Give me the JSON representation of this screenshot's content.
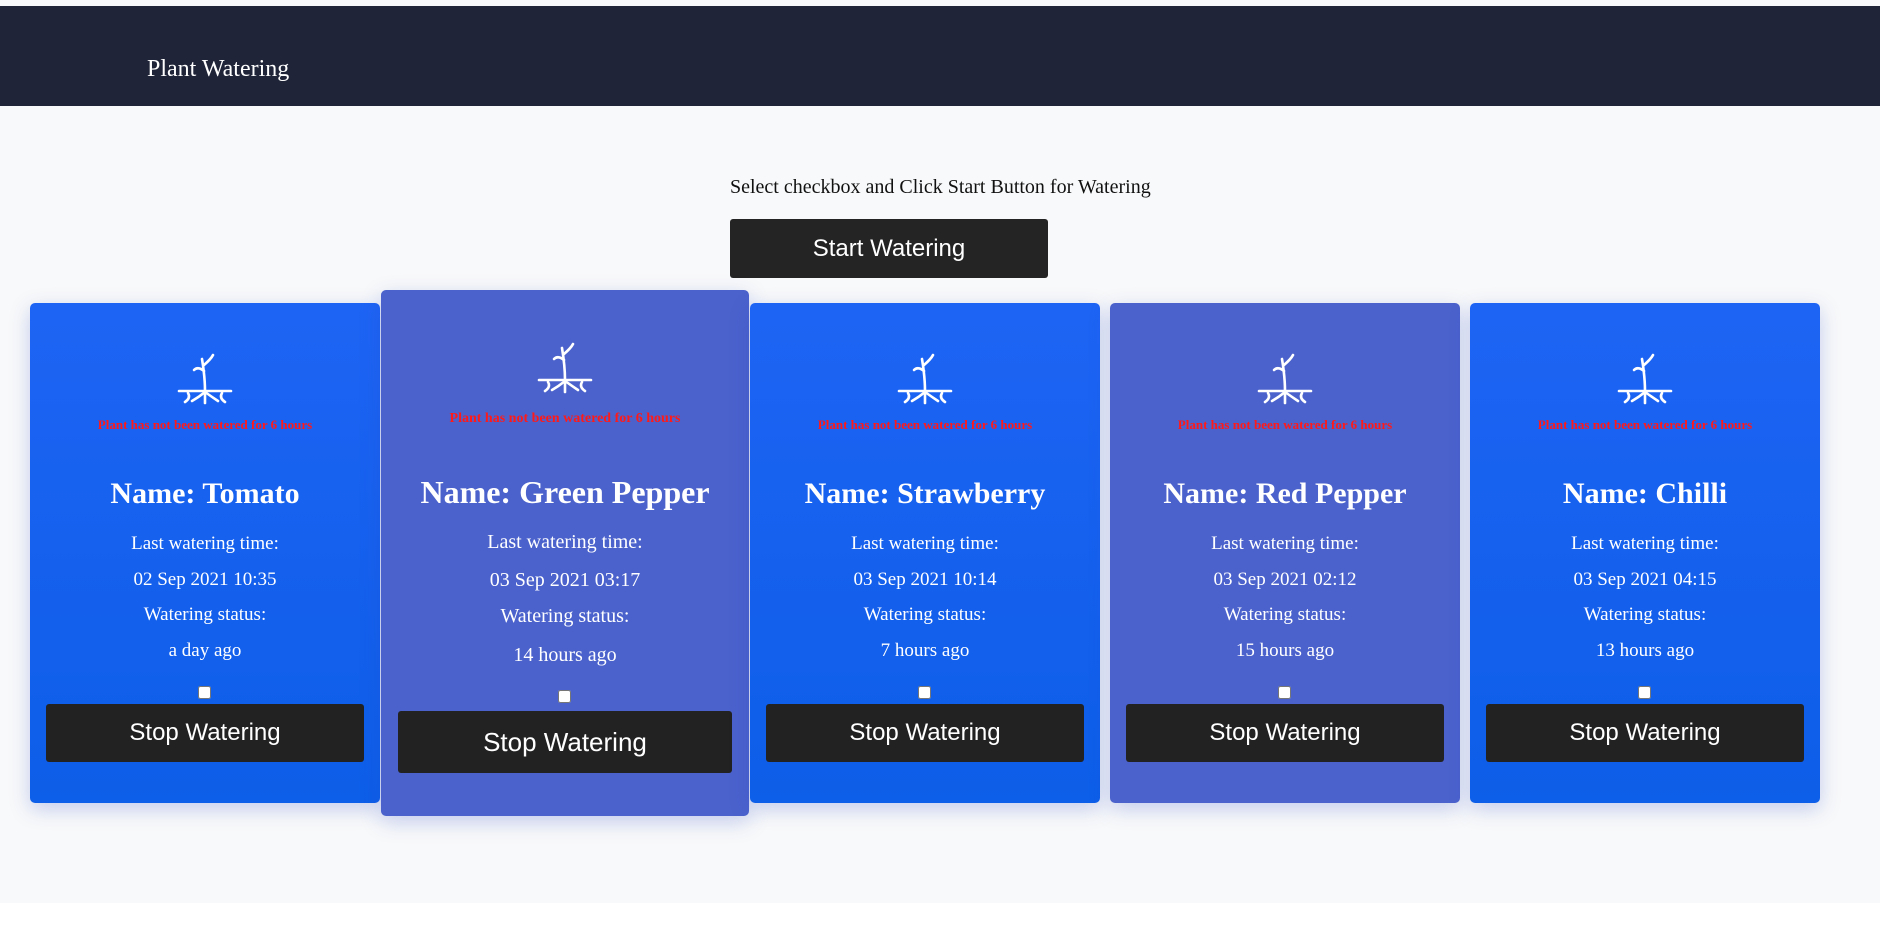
{
  "navbar": {
    "brand": "Plant Watering"
  },
  "main": {
    "instruction": "Select checkbox and Click Start Button for Watering",
    "start_button": "Start Watering"
  },
  "colors": {
    "navbar_bg": "#1f2438",
    "card_blue": "#1e64f4",
    "card_selected": "#4b62cc",
    "button_dark": "#222222",
    "warning_red": "#ff1a1a"
  },
  "cards": [
    {
      "icon": "plant-sprout-icon",
      "warning": "Plant has not been watered for 6 hours",
      "name": "Name: Tomato",
      "last_label": "Last watering time:",
      "last_time": "02 Sep 2021 10:35",
      "status_label": "Watering status:",
      "status": "a day ago",
      "checked": false,
      "stop_button": "Stop Watering"
    },
    {
      "icon": "plant-sprout-icon",
      "warning": "Plant has not been watered for 6 hours",
      "name": "Name: Green Pepper",
      "last_label": "Last watering time:",
      "last_time": "03 Sep 2021 03:17",
      "status_label": "Watering status:",
      "status": "14 hours ago",
      "checked": false,
      "stop_button": "Stop Watering"
    },
    {
      "icon": "plant-sprout-icon",
      "warning": "Plant has not been watered for 6 hours",
      "name": "Name: Strawberry",
      "last_label": "Last watering time:",
      "last_time": "03 Sep 2021 10:14",
      "status_label": "Watering status:",
      "status": "7 hours ago",
      "checked": false,
      "stop_button": "Stop Watering"
    },
    {
      "icon": "plant-sprout-icon",
      "warning": "Plant has not been watered for 6 hours",
      "name": "Name: Red Pepper",
      "last_label": "Last watering time:",
      "last_time": "03 Sep 2021 02:12",
      "status_label": "Watering status:",
      "status": "15 hours ago",
      "checked": false,
      "stop_button": "Stop Watering"
    },
    {
      "icon": "plant-sprout-icon",
      "warning": "Plant has not been watered for 6 hours",
      "name": "Name: Chilli",
      "last_label": "Last watering time:",
      "last_time": "03 Sep 2021 04:15",
      "status_label": "Watering status:",
      "status": "13 hours ago",
      "checked": false,
      "stop_button": "Stop Watering"
    }
  ]
}
